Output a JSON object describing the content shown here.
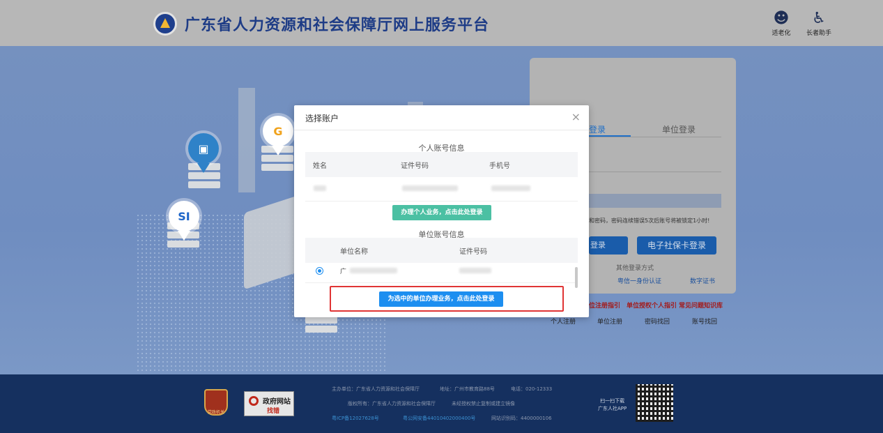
{
  "header": {
    "site_title": "广东省人力资源和社会保障厅网上服务平台",
    "tools": [
      {
        "label": "适老化",
        "icon": "elder-friendly-icon"
      },
      {
        "label": "长者助手",
        "icon": "wheelchair-icon"
      }
    ]
  },
  "hero": {
    "badges": [
      {
        "text": "G",
        "icon": "guangdong-service-icon",
        "color": "#f0a21b"
      },
      {
        "text": "SI",
        "icon": "social-insurance-icon",
        "color": "#1f66c9"
      },
      {
        "text": "",
        "icon": "briefcase-icon",
        "color": "#2f82c8"
      }
    ]
  },
  "login_panel": {
    "tab_personal": "登录",
    "tab_company": "单位登录",
    "hint": "和密码，密码连续错误5次后账号将被锁定1小时!",
    "btn_login": "登录",
    "btn_ecard": "电子社保卡登录",
    "other_methods": "其他登录方式",
    "link_ident": "粤信一身份认证",
    "link_cert": "数字证书",
    "guides": [
      "位注册指引",
      "单位授权个人指引",
      "常见问题知识库"
    ],
    "bottom_links": [
      "个人注册",
      "单位注册",
      "密码找回",
      "账号找回"
    ]
  },
  "modal": {
    "title": "选择账户",
    "close": "×",
    "personal_section": "个人账号信息",
    "personal_headers": [
      "姓名",
      "证件号码",
      "手机号"
    ],
    "personal_button": "办理个人业务，点击此处登录",
    "company_section": "单位账号信息",
    "company_headers": [
      "单位名称",
      "证件号码"
    ],
    "company_row_prefix": "广",
    "company_button": "为选中的单位办理业务，点击此处登录"
  },
  "footer": {
    "line1a": "主办单位：广东省人力资源和社会保障厅",
    "line1b": "地址：广州市教育路88号",
    "line1c": "电话：020-12333",
    "line2a": "版权所有：广东省人力资源和社会保障厅",
    "line2b": "未经授权禁止复制或建立镜像",
    "icp": "粤ICP备12027628号",
    "police": "粤公网安备44010402000400号",
    "site_code": "网站识别码：4400000106",
    "emblem_text": "党政机关",
    "gov_site_1": "政府网站",
    "gov_site_2": "找错",
    "qr_text_1": "扫一扫下载",
    "qr_text_2": "广东人社APP"
  }
}
